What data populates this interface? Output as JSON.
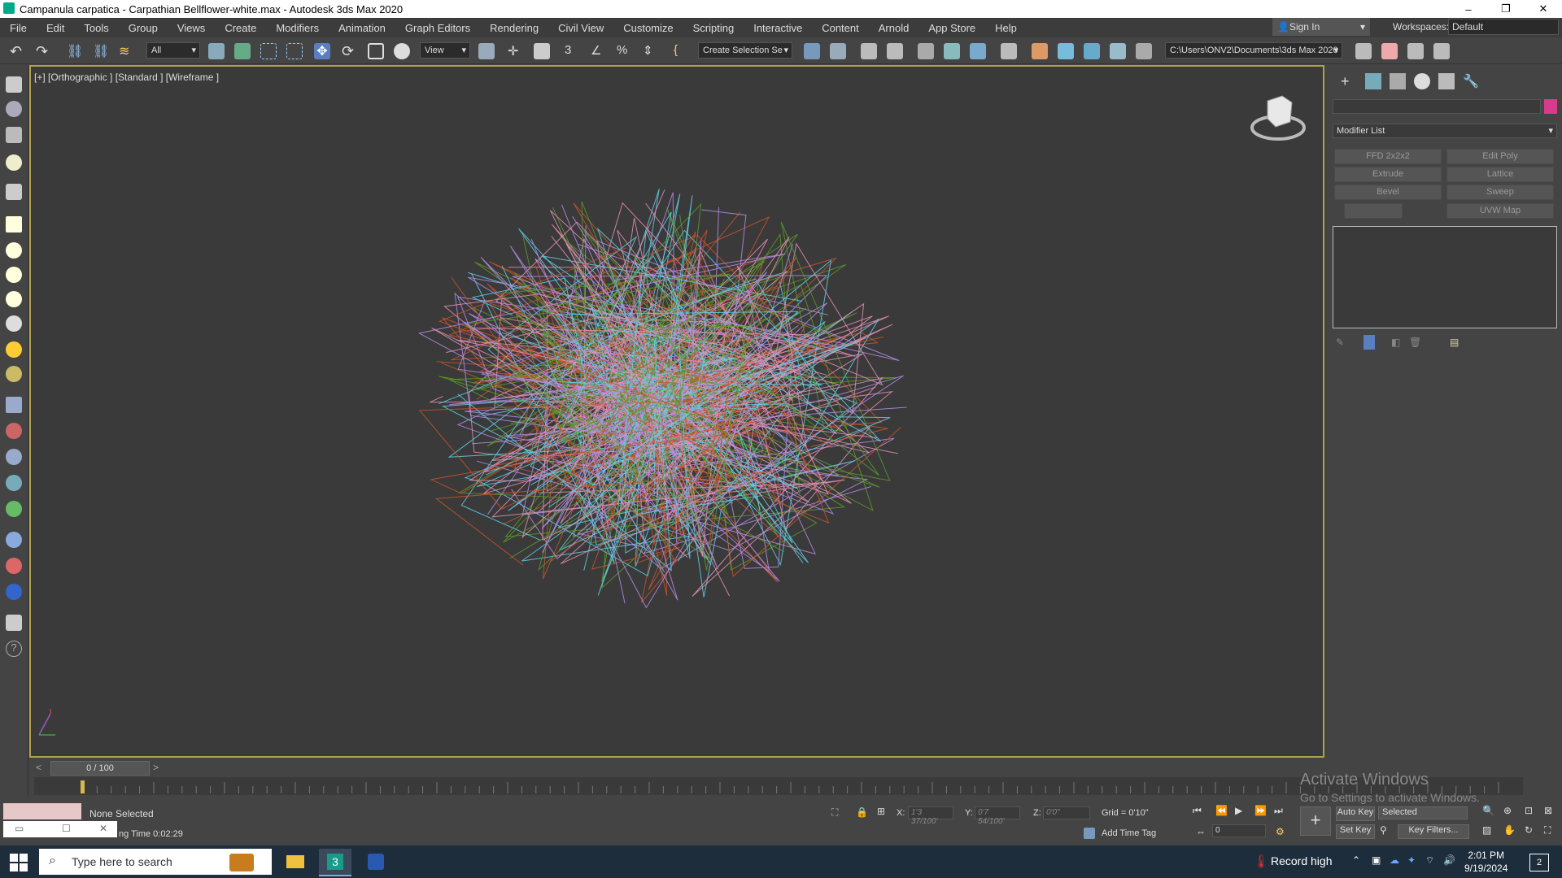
{
  "window": {
    "title": "Campanula carpatica - Carpathian Bellflower-white.max - Autodesk 3ds Max 2020",
    "controls": [
      "–",
      "❐",
      "✕"
    ]
  },
  "menu": [
    "File",
    "Edit",
    "Tools",
    "Group",
    "Views",
    "Create",
    "Modifiers",
    "Animation",
    "Graph Editors",
    "Rendering",
    "Civil View",
    "Customize",
    "Scripting",
    "Interactive",
    "Content",
    "Arnold",
    "App Store",
    "Help"
  ],
  "account": {
    "sign_in": "Sign In",
    "workspaces_label": "Workspaces:",
    "workspace": "Default"
  },
  "toolbar": {
    "selection_filter": "All",
    "reference_coord": "View",
    "named_selection": "Create Selection Se",
    "project_path": "C:\\Users\\ONV2\\Documents\\3ds Max 2020"
  },
  "viewport": {
    "label": "[+] [Orthographic ] [Standard ] [Wireframe ]"
  },
  "command_panel": {
    "modifier_list": "Modifier List",
    "buttons": [
      "FFD 2x2x2",
      "Edit Poly",
      "Extrude",
      "Lattice",
      "Bevel",
      "Sweep",
      "",
      "UVW Map"
    ]
  },
  "timeline": {
    "frame": "0 / 100",
    "prev": "<",
    "next": ">"
  },
  "status": {
    "selection": "None Selected",
    "render_time": "ng Time  0:02:29",
    "x_label": "X:",
    "x_value": "1'3 37/100'",
    "y_label": "Y:",
    "y_value": "0'7 54/100'",
    "z_label": "Z:",
    "z_value": "0'0\"",
    "grid": "Grid = 0'10\"",
    "add_time_tag": "Add Time Tag",
    "auto_key": "Auto Key",
    "key_mode": "Selected",
    "set_key": "Set Key",
    "key_filters": "Key Filters...",
    "frame_field": "0",
    "activate_1": "Activate Windows",
    "activate_2": "Go to Settings to activate Windows."
  },
  "taskbar": {
    "search_placeholder": "Type here to search",
    "weather": "Record high",
    "time": "2:01 PM",
    "date": "9/19/2024",
    "notifications": "2"
  },
  "colors": {
    "viewport_bg": "#3a3a3a",
    "panel_bg": "#444444",
    "active_border": "#b0a050",
    "wire_violet": "#b58ce6",
    "wire_cyan": "#5ed0e8",
    "wire_pink": "#e58fb5",
    "wire_green": "#5a9a2a",
    "wire_orange": "#c8552a",
    "object_color": "#d93a8c"
  }
}
